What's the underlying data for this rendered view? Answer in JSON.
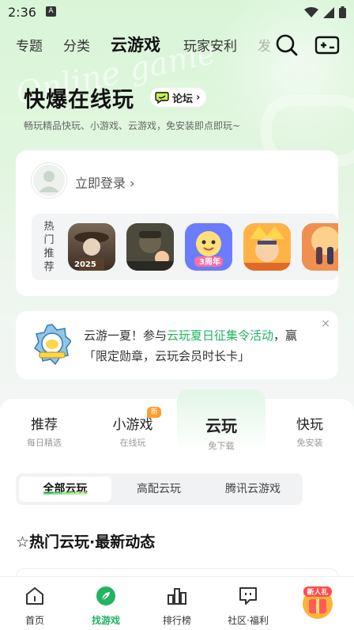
{
  "status": {
    "time": "2:36",
    "a_icon": "A"
  },
  "top_nav": {
    "tabs": [
      {
        "label": "专题"
      },
      {
        "label": "分类"
      },
      {
        "label": "云游戏"
      },
      {
        "label": "玩家安利"
      },
      {
        "label": "发"
      }
    ],
    "active_index": 2
  },
  "hero": {
    "watermark": "Online game",
    "title": "快爆在线玩",
    "forum_label": "论坛",
    "forum_chevron": "›",
    "subtitle": "畅玩精品快玩、小游戏、云游戏，免安装即点即玩~"
  },
  "login": {
    "link_text": "立即登录 ›",
    "rec_label": "热门推荐"
  },
  "games": [
    {
      "name": "game-1",
      "colors": [
        "#5a4636",
        "#c9a57a"
      ]
    },
    {
      "name": "game-2",
      "colors": [
        "#3a3a32",
        "#7d7a5e"
      ]
    },
    {
      "name": "game-3",
      "colors": [
        "#5a6bff",
        "#ffd23f"
      ]
    },
    {
      "name": "game-4",
      "colors": [
        "#ff9a2a",
        "#ffe08a"
      ]
    },
    {
      "name": "game-5",
      "colors": [
        "#e86a34",
        "#f4b06a"
      ]
    }
  ],
  "banner": {
    "text_before": "云游一夏！参与",
    "text_highlight": "云玩夏日征集令活动",
    "text_after": "，赢「限定勋章，云玩会员时长卡」",
    "close": "×"
  },
  "categories": [
    {
      "main": "推荐",
      "sub": "每日精选"
    },
    {
      "main": "小游戏",
      "sub": "在线玩",
      "badge": "新"
    },
    {
      "main": "云玩",
      "sub": "免下载"
    },
    {
      "main": "快玩",
      "sub": "免安装"
    }
  ],
  "sub_tabs": [
    {
      "label": "全部云玩"
    },
    {
      "label": "高配云玩"
    },
    {
      "label": "腾讯云游戏"
    }
  ],
  "section_title": "☆热门云玩·最新动态",
  "bottom_nav": [
    {
      "label": "首页",
      "icon": "home-icon"
    },
    {
      "label": "找游戏",
      "icon": "leaf-icon"
    },
    {
      "label": "排行榜",
      "icon": "chart-icon"
    },
    {
      "label": "社区·福利",
      "icon": "chat-icon"
    }
  ],
  "gift_badge": "新人礼",
  "colors": {
    "accent": "#22b460",
    "badge": "#ff9c2b"
  }
}
